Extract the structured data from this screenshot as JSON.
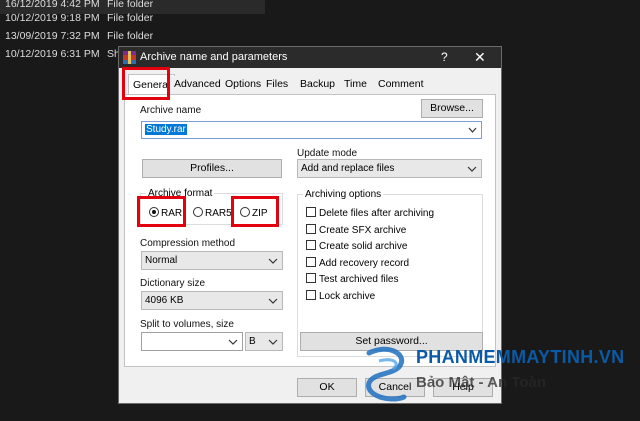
{
  "explorer": {
    "rows": [
      {
        "date": "16/12/2019 4:42 PM",
        "type": "File folder"
      },
      {
        "date": "10/12/2019 9:18 PM",
        "type": "File folder"
      },
      {
        "date": "13/09/2019 7:32 PM",
        "type": "File folder"
      },
      {
        "date": "10/12/2019 6:31 PM",
        "type": "Sh"
      }
    ]
  },
  "dialog": {
    "title": "Archive name and parameters",
    "help": "?",
    "close": "✕",
    "tabs": [
      "General",
      "Advanced",
      "Options",
      "Files",
      "Backup",
      "Time",
      "Comment"
    ],
    "active_tab": "General"
  },
  "general": {
    "archive_name_label": "Archive name",
    "browse_label": "Browse...",
    "archive_name_value": "Study.rar",
    "profiles_label": "Profiles...",
    "update_mode_label": "Update mode",
    "update_mode_value": "Add and replace files",
    "archive_format_label": "Archive format",
    "formats": [
      {
        "label": "RAR",
        "selected": true
      },
      {
        "label": "RAR5",
        "selected": false
      },
      {
        "label": "ZIP",
        "selected": false
      }
    ],
    "archiving_options_label": "Archiving options",
    "options": [
      "Delete files after archiving",
      "Create SFX archive",
      "Create solid archive",
      "Add recovery record",
      "Test archived files",
      "Lock archive"
    ],
    "compression_method_label": "Compression method",
    "compression_method_value": "Normal",
    "dictionary_size_label": "Dictionary size",
    "dictionary_size_value": "4096 KB",
    "split_label": "Split to volumes, size",
    "split_value": "",
    "split_unit": "B",
    "set_password_label": "Set password..."
  },
  "buttons": {
    "ok": "OK",
    "cancel": "Cancel",
    "help": "Help"
  },
  "watermark": {
    "brand": "PHANMEMMAYTINH.VN",
    "tagline": "Bảo Mật - An Toàn"
  },
  "colors": {
    "highlight": "#e3000f",
    "selection": "#0078d7",
    "brand": "#0b5aa6"
  }
}
